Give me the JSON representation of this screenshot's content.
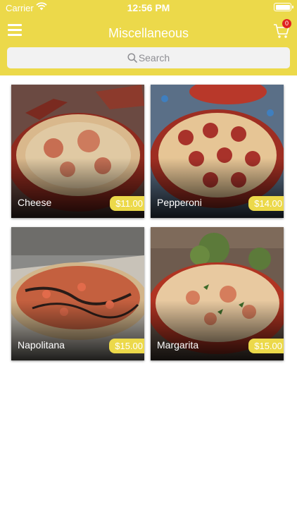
{
  "status_bar": {
    "carrier": "Carrier",
    "time": "12:56 PM"
  },
  "header": {
    "title": "Miscellaneous",
    "cart_count": "0"
  },
  "search": {
    "placeholder": "Search"
  },
  "colors": {
    "accent": "#ecd94a",
    "badge": "#e02020"
  },
  "products": [
    {
      "name": "Cheese",
      "price": "$11.00"
    },
    {
      "name": "Pepperoni",
      "price": "$14.00"
    },
    {
      "name": "Napolitana",
      "price": "$15.00"
    },
    {
      "name": "Margarita",
      "price": "$15.00"
    }
  ]
}
